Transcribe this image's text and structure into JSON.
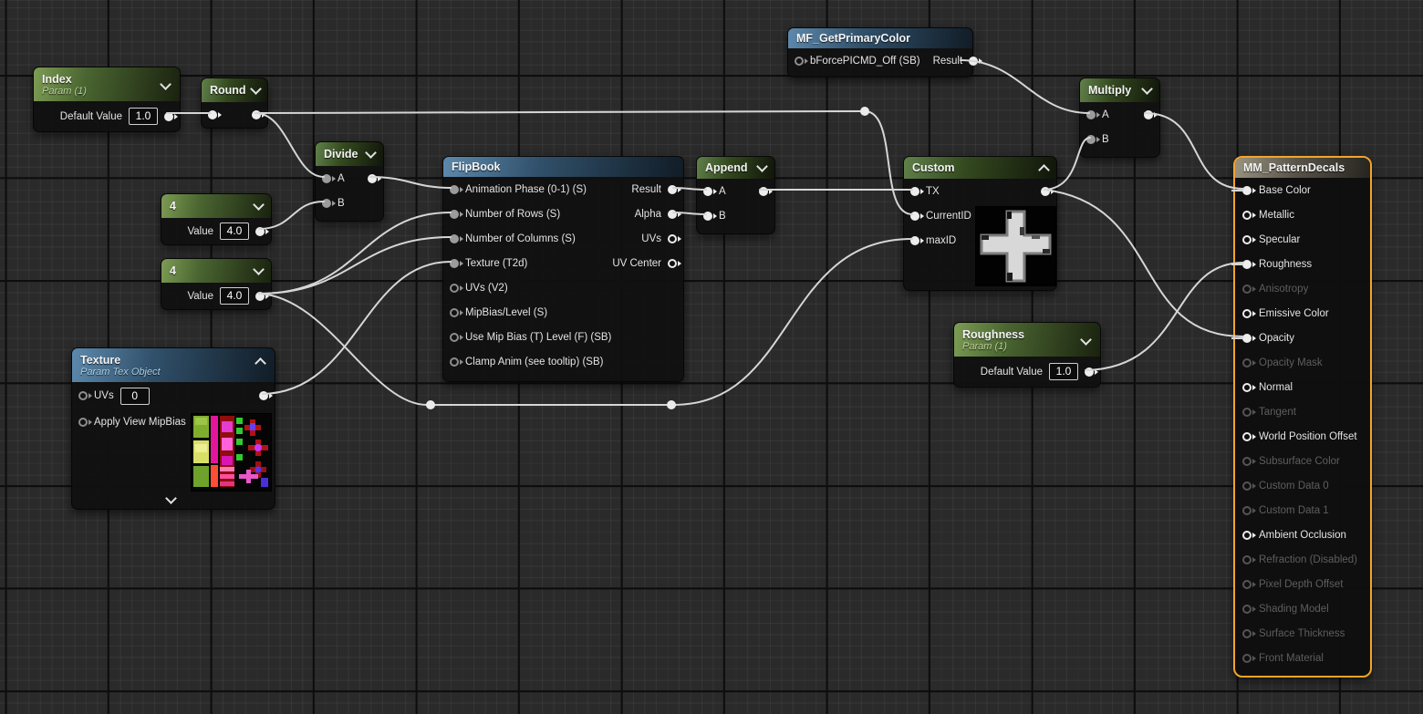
{
  "colors": {
    "selection_orange": "#F3A42A",
    "wire": "#D6D6D6",
    "param_header_green": "#7D9C54",
    "function_header_green": "#60804A",
    "texture_header_blue": "#5D89AD",
    "output_header_gray": "#9A9481",
    "background": "#2A2A2A"
  },
  "nodes": {
    "index": {
      "title": "Index",
      "subtitle": "Param (1)",
      "field_label": "Default Value",
      "field_value": "1.0"
    },
    "round": {
      "title": "Round"
    },
    "divide": {
      "title": "Divide",
      "input_a": "A",
      "input_b": "B"
    },
    "four_top": {
      "title": "4",
      "field_label": "Value",
      "field_value": "4.0"
    },
    "four_bottom": {
      "title": "4",
      "field_label": "Value",
      "field_value": "4.0"
    },
    "texture": {
      "title": "Texture",
      "subtitle": "Param Tex Object",
      "uvs_label": "UVs",
      "uvs_value": "0",
      "mipbias_label": "Apply View MipBias"
    },
    "flipbook": {
      "title": "FlipBook",
      "inputs": [
        "Animation Phase (0-1) (S)",
        "Number of Rows (S)",
        "Number of Columns (S)",
        "Texture (T2d)",
        "UVs (V2)",
        "MipBias/Level (S)",
        "Use Mip Bias (T) Level (F) (SB)",
        "Clamp Anim (see tooltip) (SB)"
      ],
      "outputs": [
        "Result",
        "Alpha",
        "UVs",
        "UV Center"
      ]
    },
    "append": {
      "title": "Append",
      "input_a": "A",
      "input_b": "B"
    },
    "mf_get_primary_color": {
      "title": "MF_GetPrimaryColor",
      "input": "bForcePICMD_Off (SB)",
      "output": "Result"
    },
    "custom": {
      "title": "Custom",
      "inputs": [
        "TX",
        "CurrentID",
        "maxID"
      ]
    },
    "multiply": {
      "title": "Multiply",
      "input_a": "A",
      "input_b": "B"
    },
    "roughness": {
      "title": "Roughness",
      "subtitle": "Param (1)",
      "field_label": "Default Value",
      "field_value": "1.0"
    },
    "mm_pattern_decals": {
      "title": "MM_PatternDecals",
      "pins": [
        {
          "label": "Base Color",
          "state": "connected"
        },
        {
          "label": "Metallic",
          "state": "open"
        },
        {
          "label": "Specular",
          "state": "open"
        },
        {
          "label": "Roughness",
          "state": "connected"
        },
        {
          "label": "Anisotropy",
          "state": "disabled"
        },
        {
          "label": "Emissive Color",
          "state": "open"
        },
        {
          "label": "Opacity",
          "state": "connected"
        },
        {
          "label": "Opacity Mask",
          "state": "disabled"
        },
        {
          "label": "Normal",
          "state": "open"
        },
        {
          "label": "Tangent",
          "state": "disabled"
        },
        {
          "label": "World Position Offset",
          "state": "open"
        },
        {
          "label": "Subsurface Color",
          "state": "disabled"
        },
        {
          "label": "Custom Data 0",
          "state": "disabled"
        },
        {
          "label": "Custom Data 1",
          "state": "disabled"
        },
        {
          "label": "Ambient Occlusion",
          "state": "open"
        },
        {
          "label": "Refraction (Disabled)",
          "state": "disabled"
        },
        {
          "label": "Pixel Depth Offset",
          "state": "disabled"
        },
        {
          "label": "Shading Model",
          "state": "disabled"
        },
        {
          "label": "Surface Thickness",
          "state": "disabled"
        },
        {
          "label": "Front Material",
          "state": "disabled"
        }
      ]
    }
  },
  "connections": [
    {
      "from": "Index",
      "to": "Round"
    },
    {
      "from": "Round",
      "to": "Divide.A"
    },
    {
      "from": "Round",
      "to": "Custom.CurrentID"
    },
    {
      "from": "4 (top)",
      "to": "Divide.B"
    },
    {
      "from": "Divide",
      "to": "FlipBook.Animation Phase (0-1) (S)"
    },
    {
      "from": "4 (bottom)",
      "to": "FlipBook.Number of Rows (S)"
    },
    {
      "from": "4 (bottom)",
      "to": "FlipBook.Number of Columns (S)"
    },
    {
      "from": "4 (bottom)",
      "to": "Custom.maxID"
    },
    {
      "from": "Texture",
      "to": "FlipBook.Texture (T2d)"
    },
    {
      "from": "FlipBook.Result",
      "to": "Append.A"
    },
    {
      "from": "FlipBook.Alpha",
      "to": "Append.B"
    },
    {
      "from": "Append",
      "to": "Custom.TX"
    },
    {
      "from": "MF_GetPrimaryColor.Result",
      "to": "Multiply.A"
    },
    {
      "from": "Custom",
      "to": "Multiply.B"
    },
    {
      "from": "Custom",
      "to": "MM_PatternDecals.Opacity"
    },
    {
      "from": "Multiply",
      "to": "MM_PatternDecals.Base Color"
    },
    {
      "from": "Roughness",
      "to": "MM_PatternDecals.Roughness"
    }
  ]
}
